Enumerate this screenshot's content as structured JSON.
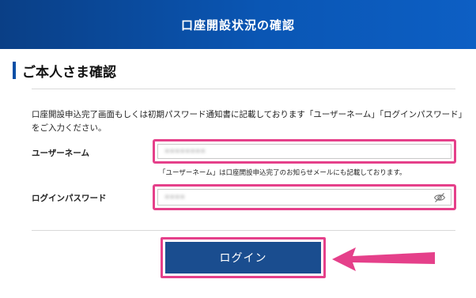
{
  "header": {
    "title": "口座開設状況の確認"
  },
  "section": {
    "title": "ご本人さま確認"
  },
  "intro": {
    "text": "口座開設申込完了画面もしくは初期パスワード通知書に記載しております「ユーザーネーム」「ログインパスワード」をご入力ください。"
  },
  "form": {
    "username": {
      "label": "ユーザーネーム",
      "value": "••••••••",
      "note": "「ユーザーネーム」は口座開設申込完了のお知らせメールにも記載しております。"
    },
    "password": {
      "label": "ログインパスワード",
      "value": "••••"
    },
    "login_label": "ログイン"
  },
  "colors": {
    "header_start": "#0a3f86",
    "header_end": "#0d5fc4",
    "accent_bar": "#0a4fa6",
    "button": "#1a4d8f",
    "highlight": "#e5408a"
  },
  "icons": {
    "password_toggle": "eye-off-icon",
    "annotation": "arrow-left-icon"
  }
}
